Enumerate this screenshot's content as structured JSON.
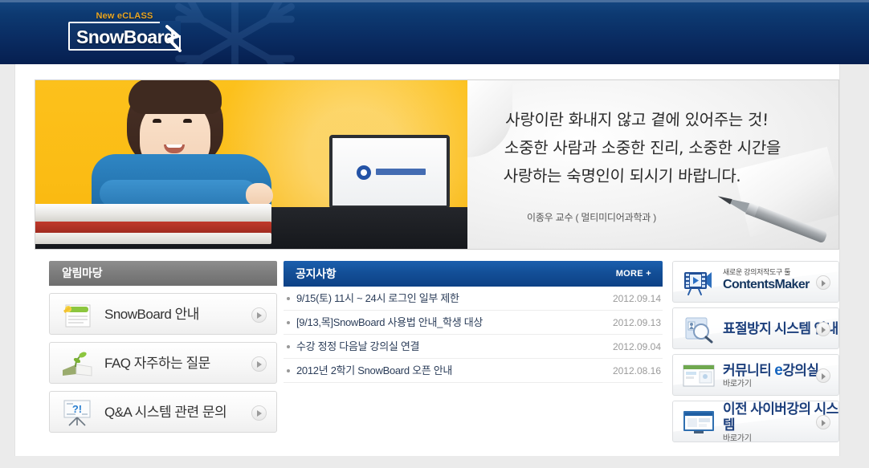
{
  "header": {
    "logo_eclass": "New eCLASS",
    "logo_name": "SnowBoard"
  },
  "banner": {
    "quote_line1": "사랑이란 화내지 않고 곁에 있어주는 것!",
    "quote_line2": "소중한 사람과 소중한 진리, 소중한 시간을",
    "quote_line3": "사랑하는 숙명인이 되시기 바랍니다.",
    "author": "이종우 교수 ( 멀티미디어과학과 )"
  },
  "left_panel": {
    "title": "알림마당",
    "items": [
      {
        "label": "SnowBoard 안내",
        "icon": "notepad-icon"
      },
      {
        "label": "FAQ 자주하는 질문",
        "icon": "open-book-sprout-icon"
      },
      {
        "label": "Q&A 시스템 관련 문의",
        "icon": "question-board-icon"
      }
    ]
  },
  "notice_panel": {
    "title": "공지사항",
    "more_label": "MORE +",
    "rows": [
      {
        "text": "9/15(토) 11시 ~ 24시 로그인 일부 제한",
        "date": "2012.09.14"
      },
      {
        "text": "[9/13,목]SnowBoard 사용법 안내_학생 대상",
        "date": "2012.09.13"
      },
      {
        "text": "수강 정정 다음날 강의실 연결",
        "date": "2012.09.04"
      },
      {
        "text": "2012년 2학기 SnowBoard 오픈 안내",
        "date": "2012.08.16"
      }
    ]
  },
  "side_banners": [
    {
      "sub": "새로운 강의저작도구 툴",
      "main": "ContentsMaker",
      "goto": "",
      "icon": "film-play-icon"
    },
    {
      "sub": "",
      "main": "표절방지 시스템 안내",
      "goto": "",
      "icon": "magnifier-document-icon"
    },
    {
      "sub": "",
      "main_prefix": "커뮤니티 ",
      "main_accent": "e",
      "main_suffix": "강의실",
      "goto": "바로가기",
      "icon": "browser-window-icon"
    },
    {
      "sub": "",
      "main": "이전 사이버강의 시스템",
      "goto": "바로가기",
      "icon": "monitor-screen-icon"
    }
  ],
  "colors": {
    "header_blue": "#0d3a72",
    "notice_blue": "#134f97",
    "panel_gray": "#7c7c7c",
    "accent_gold": "#e8a626",
    "banner_yellow": "#fbbc14",
    "brand_navy": "#1c3f7c"
  }
}
